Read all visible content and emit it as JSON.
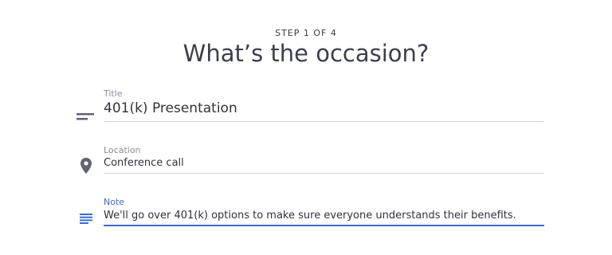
{
  "header": {
    "step": "STEP 1 OF 4",
    "title": "What’s the occasion?"
  },
  "fields": {
    "title": {
      "label": "Title",
      "value": "401(k) Presentation",
      "icon": "short-text-icon"
    },
    "location": {
      "label": "Location",
      "value": "Conference call",
      "icon": "location-pin-icon"
    },
    "note": {
      "label": "Note",
      "value": "We'll go over 401(k) options to make sure everyone understands their benefits.",
      "icon": "notes-icon"
    }
  },
  "colors": {
    "accent": "#3b6bd1",
    "icon": "#5f6470",
    "divider": "#d4d6db"
  }
}
